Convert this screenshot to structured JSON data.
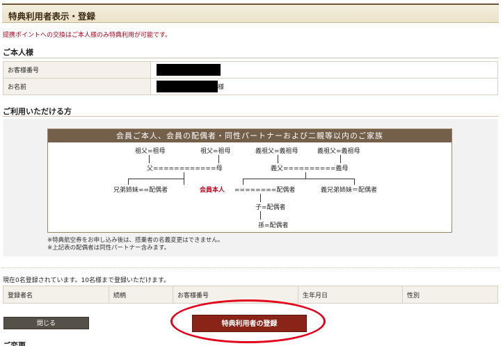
{
  "header": {
    "title": "特典利用者表示・登録"
  },
  "notice": "提携ポイントへの交換はご本人様のみ特典利用が可能です。",
  "self_section": {
    "title": "ご本人様",
    "rows": [
      {
        "label": "お客様番号",
        "value_hidden": true,
        "suffix": ""
      },
      {
        "label": "お名前",
        "value_hidden": true,
        "suffix": "様"
      }
    ]
  },
  "eligible_section": {
    "title": "ご利用いただける方",
    "tree_header": "会員ご本人、会員の配偶者・同性パートナーおよび二親等以内のご家族",
    "nodes": {
      "gp1": "祖父=祖母",
      "gp2": "祖父=祖母",
      "gp3": "義祖父=義祖母",
      "gp4": "義祖父=義祖母",
      "parents": "父============母",
      "in_law_parents": "義父==========義母",
      "siblings": "兄弟姉妹==配偶者",
      "member": "会員本人",
      "member_spouse": "========配偶者",
      "in_law_siblings": "義兄弟姉妹＝配偶者",
      "child": "子=配偶者",
      "grandchild": "孫=配偶者"
    },
    "notes": [
      "※特典航空券をお申し込み後は、搭乗者の名義変更はできません。",
      "※上記表の配偶者は同性パートナー含みます。"
    ]
  },
  "registration": {
    "count_text": "現在0名登録されています。10名様まで登録いただけます。",
    "columns": [
      "登録者名",
      "続柄",
      "お客様番号",
      "生年月日",
      "性別"
    ]
  },
  "buttons": {
    "close": "閉じる",
    "register": "特典利用者の登録"
  },
  "bottom_section_title": "ご変更",
  "colors": {
    "accent_red": "#b3001b",
    "header_brown": "#74604a",
    "register_button": "#8a2418",
    "highlight": "#e3001b"
  }
}
